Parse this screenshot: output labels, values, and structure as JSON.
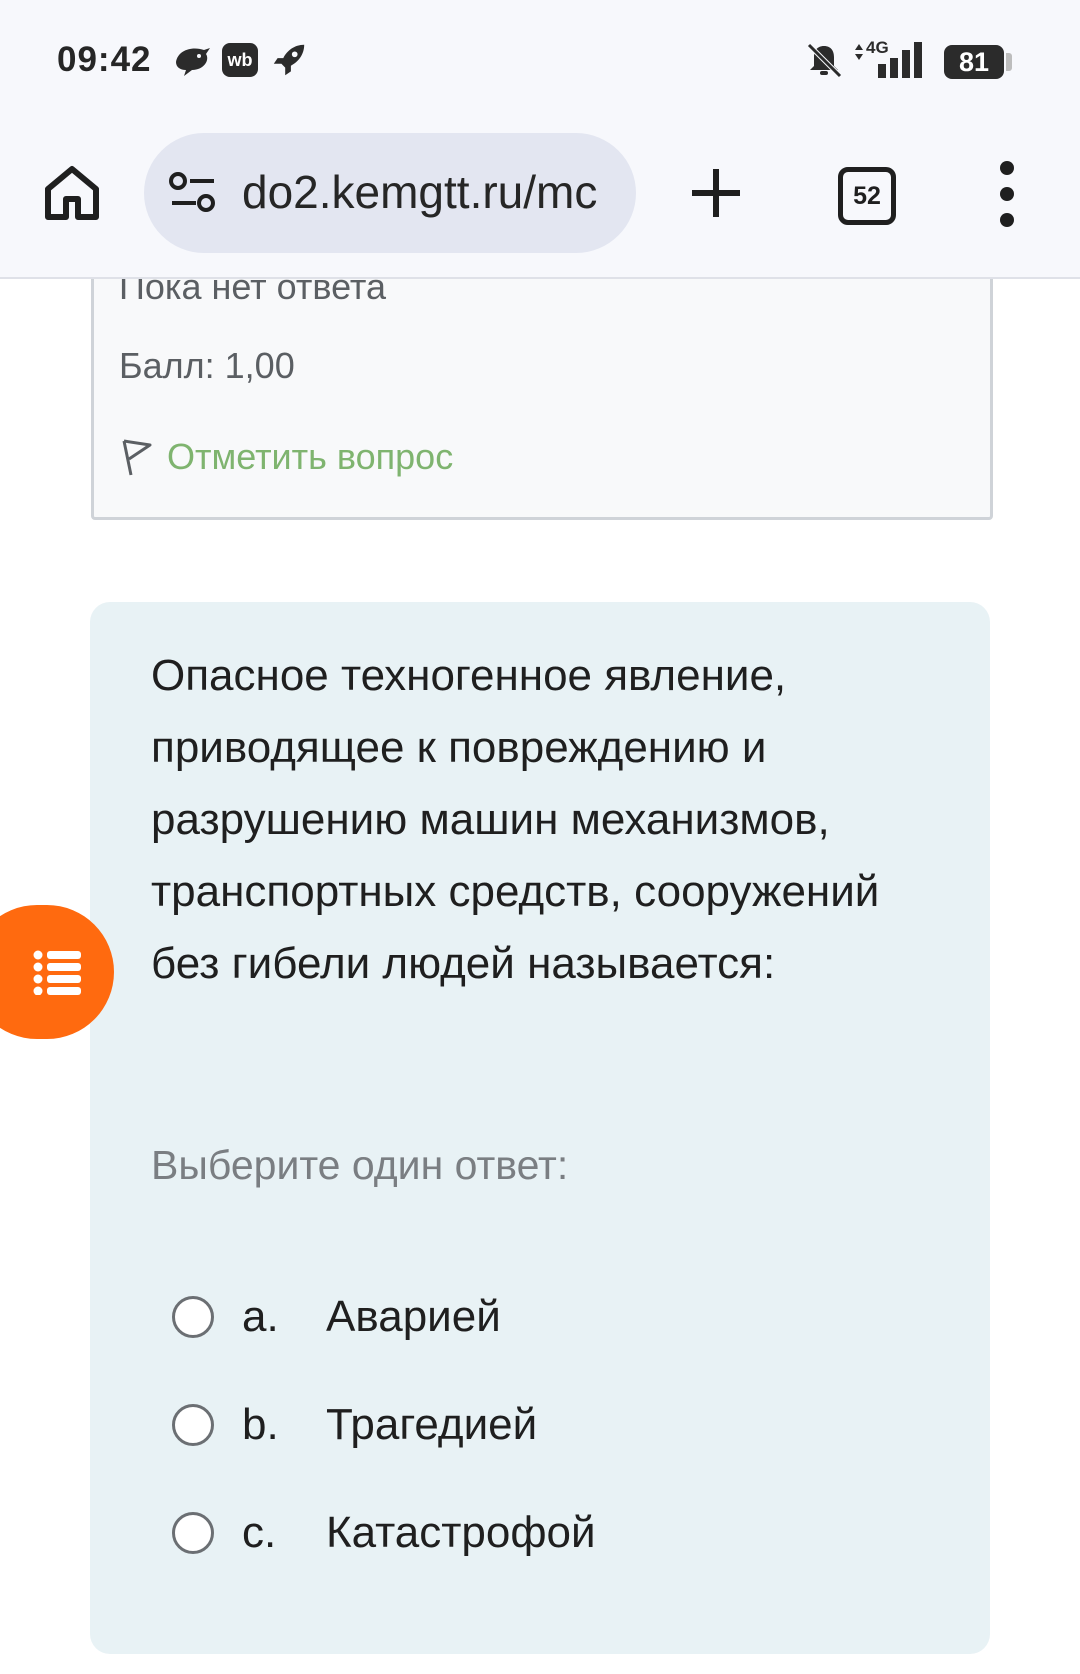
{
  "status_bar": {
    "time": "09:42",
    "left_icons": [
      "hedgehog-app-icon",
      "wb-app-icon",
      "rocket-icon"
    ],
    "wb_label": "wb",
    "network_label": "4G",
    "battery": "81"
  },
  "browser": {
    "url": "do2.kemgtt.ru/mc",
    "tab_count": "52"
  },
  "prev_question": {
    "status": "Пока нет ответа",
    "score": "Балл: 1,00",
    "flag_label": "Отметить вопрос"
  },
  "question": {
    "text": "Опасное техногенное явление, приводящее к повреждению и разрушению машин механизмов, транспортных средств, сооружений без гибели людей называется:",
    "prompt": "Выберите один ответ:",
    "options": [
      {
        "letter": "a.",
        "text": "Аварией"
      },
      {
        "letter": "b.",
        "text": "Трагедией"
      },
      {
        "letter": "c.",
        "text": "Катастрофой"
      }
    ]
  },
  "colors": {
    "accent_orange": "#ff6a0f",
    "link_green": "#7fb46f",
    "question_bg": "#e8f2f5"
  }
}
